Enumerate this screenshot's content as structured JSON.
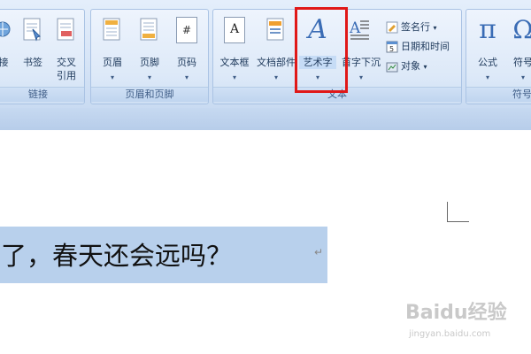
{
  "ribbon": {
    "groups": {
      "links": {
        "label": "链接"
      },
      "header_footer": {
        "label": "页眉和页脚"
      },
      "text": {
        "label": "文本"
      },
      "symbols": {
        "label": "符号"
      }
    },
    "buttons": {
      "hyperlink_partial": "接",
      "bookmark": "书签",
      "cross_ref_line1": "交叉",
      "cross_ref_line2": "引用",
      "header": "页眉",
      "footer": "页脚",
      "page_number": "页码",
      "text_box": "文本框",
      "quick_parts": "文档部件",
      "wordart": "艺术字",
      "drop_cap": "首字下沉",
      "signature_line": "签名行",
      "date_time": "日期和时间",
      "object": "对象",
      "equation": "公式",
      "symbol": "符号",
      "dropdown_glyph": "▾"
    },
    "icons": {
      "wordart_glyph": "A",
      "equation_glyph": "π",
      "symbol_glyph": "Ω",
      "page_number_glyph": "#",
      "text_box_glyph": "A"
    }
  },
  "document": {
    "selected_text": "来了，春天还会远吗？",
    "paragraph_mark": "↵"
  },
  "watermark": {
    "brand": "Baidu经验",
    "url": "jingyan.baidu.com"
  },
  "colors": {
    "highlight": "#e01818",
    "selection": "#b8d0ec",
    "ribbon_text": "#1e395b"
  }
}
